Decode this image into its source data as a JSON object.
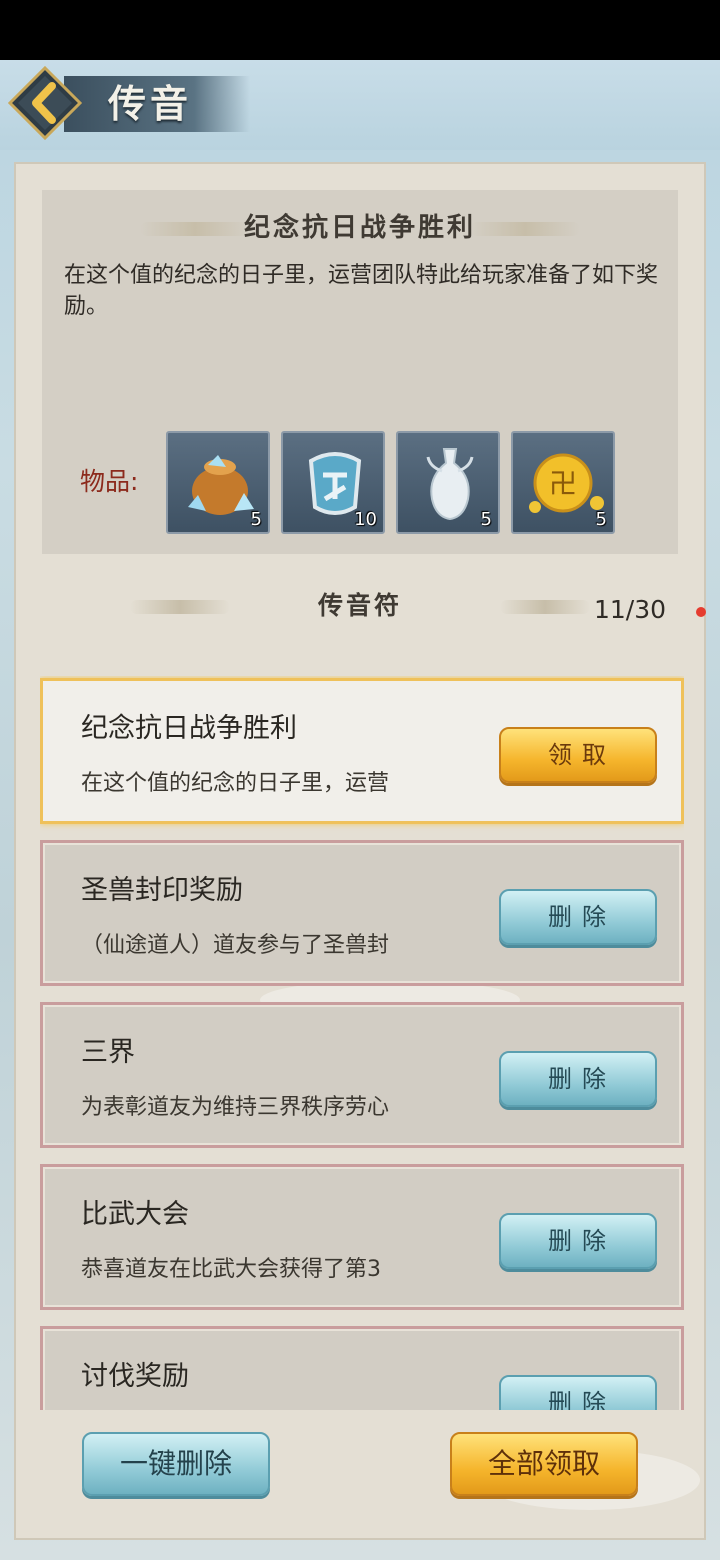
{
  "header": {
    "title": "传音"
  },
  "detail": {
    "title": "纪念抗日战争胜利",
    "body": "在这个值的纪念的日子里，运营团队特此给玩家准备了如下奖励。",
    "items_label": "物品:",
    "items": [
      {
        "icon": "spirit-stone-bag-icon",
        "count": "5"
      },
      {
        "icon": "phantom-token-icon",
        "count": "10"
      },
      {
        "icon": "porcelain-vase-icon",
        "count": "5"
      },
      {
        "icon": "gold-ingot-icon",
        "count": "5"
      }
    ]
  },
  "list": {
    "title": "传音符",
    "count": "11/30",
    "items": [
      {
        "title": "纪念抗日战争胜利",
        "preview": "在这个值的纪念的日子里，运营",
        "action": "领取"
      },
      {
        "title": "圣兽封印奖励",
        "preview": "（仙途道人）道友参与了圣兽封",
        "action": "删除"
      },
      {
        "title": "三界",
        "preview": "为表彰道友为维持三界秩序劳心",
        "action": "删除"
      },
      {
        "title": "比武大会",
        "preview": "恭喜道友在比武大会获得了第3",
        "action": "删除"
      },
      {
        "title": "讨伐奖励",
        "preview": "",
        "action": "删除"
      }
    ]
  },
  "footer": {
    "delete_all": "一键删除",
    "claim_all": "全部领取"
  },
  "colors": {
    "gold_button": "#f5b52c",
    "blue_button": "#92cbd7",
    "label_red": "#8c2a1c"
  }
}
